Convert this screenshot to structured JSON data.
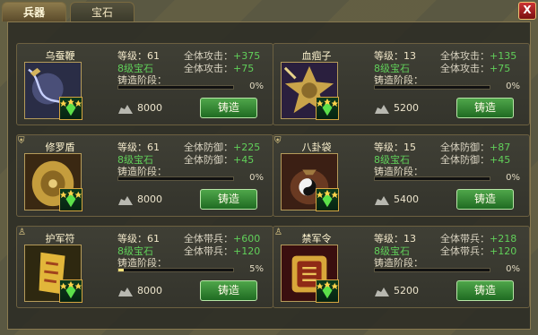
{
  "tabs": [
    {
      "label": "兵器",
      "active": true
    },
    {
      "label": "宝石",
      "active": false
    }
  ],
  "close_label": "X",
  "cards": [
    {
      "name": "乌蚕鞭",
      "level_label": "等级：61",
      "gem_label": "8级宝石",
      "stat1_label": "全体攻击：",
      "stat1_value": "+375",
      "stat2_label": "全体攻击：",
      "stat2_value": "+75",
      "stage_label": "铸造阶段：",
      "progress_text": "0%",
      "progress": 0,
      "cost": "8000",
      "forge_label": "铸造",
      "icon": "whip-icon"
    },
    {
      "name": "血痼子",
      "level_label": "等级：13",
      "gem_label": "8级宝石",
      "stat1_label": "全体攻击：",
      "stat1_value": "+135",
      "stat2_label": "全体攻击：",
      "stat2_value": "+75",
      "stage_label": "铸造阶段：",
      "progress_text": "0%",
      "progress": 0,
      "cost": "5200",
      "forge_label": "铸造",
      "icon": "star-blade-icon"
    },
    {
      "name": "修罗盾",
      "level_label": "等级：61",
      "gem_label": "8级宝石",
      "stat1_label": "全体防御：",
      "stat1_value": "+225",
      "stat2_label": "全体防御：",
      "stat2_value": "+45",
      "stage_label": "铸造阶段：",
      "progress_text": "0%",
      "progress": 0,
      "cost": "8000",
      "forge_label": "铸造",
      "icon": "shield-icon"
    },
    {
      "name": "八卦袋",
      "level_label": "等级：15",
      "gem_label": "8级宝石",
      "stat1_label": "全体防御：",
      "stat1_value": "+87",
      "stat2_label": "全体防御：",
      "stat2_value": "+45",
      "stage_label": "铸造阶段：",
      "progress_text": "0%",
      "progress": 0,
      "cost": "5400",
      "forge_label": "铸造",
      "icon": "bagua-bag-icon"
    },
    {
      "name": "护军符",
      "level_label": "等级：61",
      "gem_label": "8级宝石",
      "stat1_label": "全体带兵：",
      "stat1_value": "+600",
      "stat2_label": "全体带兵：",
      "stat2_value": "+120",
      "stage_label": "铸造阶段：",
      "progress_text": "5%",
      "progress": 5,
      "cost": "8000",
      "forge_label": "铸造",
      "icon": "talisman-icon"
    },
    {
      "name": "禁军令",
      "level_label": "等级：13",
      "gem_label": "8级宝石",
      "stat1_label": "全体带兵：",
      "stat1_value": "+218",
      "stat2_label": "全体带兵：",
      "stat2_value": "+120",
      "stage_label": "铸造阶段：",
      "progress_text": "0%",
      "progress": 0,
      "cost": "5200",
      "forge_label": "铸造",
      "icon": "token-icon"
    }
  ]
}
